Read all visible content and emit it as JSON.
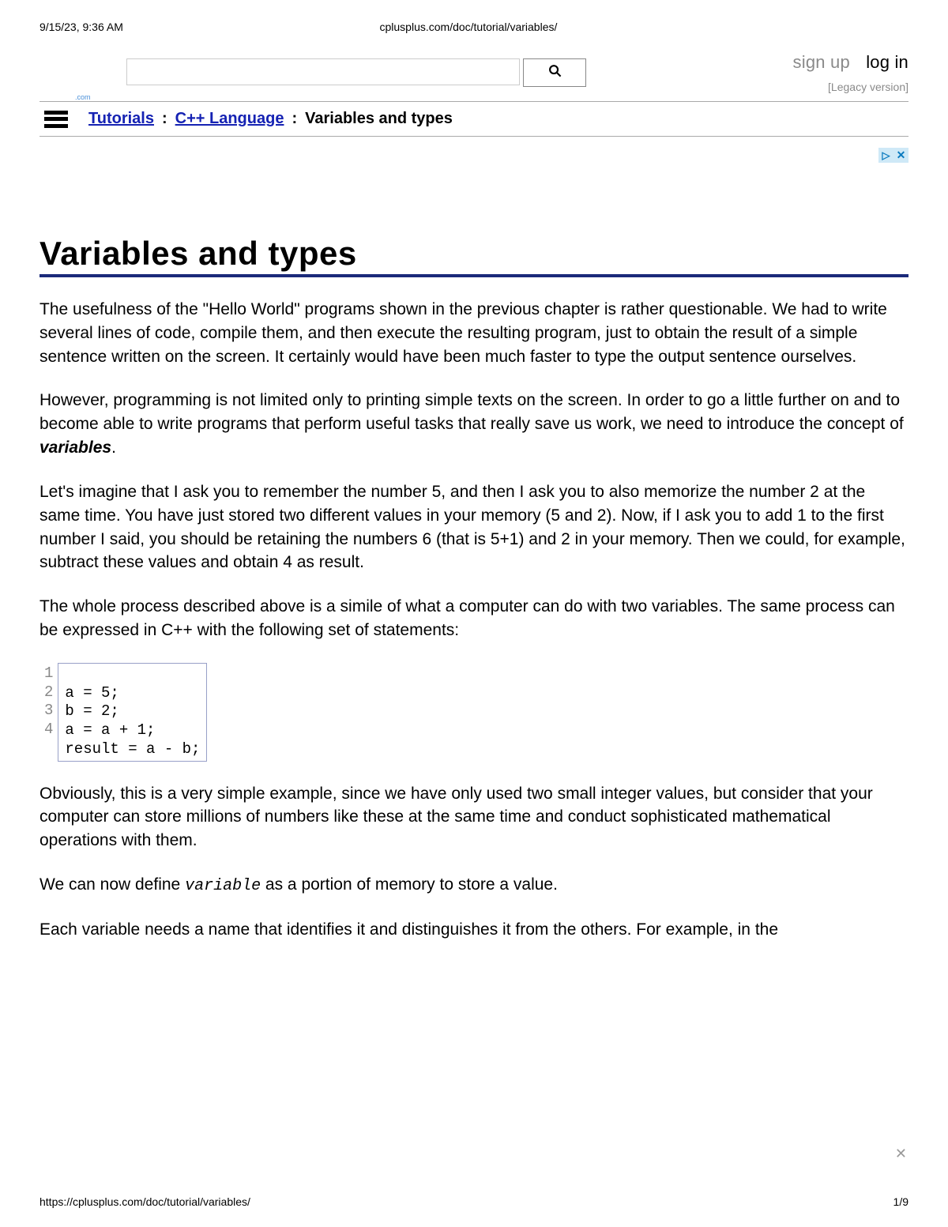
{
  "print_header": {
    "left": "9/15/23, 9:36 AM",
    "center": "cplusplus.com/doc/tutorial/variables/"
  },
  "header": {
    "signup": "sign up",
    "login": "log in",
    "legacy": "[Legacy version]",
    "search_placeholder": "",
    "logo_fragment": ".com"
  },
  "breadcrumb": {
    "link1": "Tutorials",
    "link2": "C++ Language",
    "current": "Variables and types",
    "sep": ":"
  },
  "ad": {
    "play": "▷",
    "close": "✕"
  },
  "article": {
    "title": "Variables and types",
    "p1": "The usefulness of the \"Hello World\" programs shown in the previous chapter is rather questionable. We had to write several lines of code, compile them, and then execute the resulting program, just to obtain the result of a simple sentence written on the screen. It certainly would have been much faster to type the output sentence ourselves.",
    "p2_a": "However, programming is not limited only to printing simple texts on the screen. In order to go a little further on and to become able to write programs that perform useful tasks that really save us work, we need to introduce the concept of ",
    "p2_var": "variables",
    "p2_b": ".",
    "p3": "Let's imagine that I ask you to remember the number 5, and then I ask you to also memorize the number 2 at the same time. You have just stored two different values in your memory (5 and 2). Now, if I ask you to add 1 to the first number I said, you should be retaining the numbers 6 (that is 5+1) and 2 in your memory. Then we could, for example, subtract these values and obtain 4 as result.",
    "p4": "The whole process described above is a simile of what a computer can do with two variables. The same process can be expressed in C++ with the following set of statements:",
    "code_lines": {
      "n1": "1",
      "l1": "a = 5;",
      "n2": "2",
      "l2": "b = 2;",
      "n3": "3",
      "l3": "a = a + 1;",
      "n4": "4",
      "l4": "result = a - b;"
    },
    "p5": "Obviously, this is a very simple example, since we have only used two small integer values, but consider that your computer can store millions of numbers like these at the same time and conduct sophisticated mathematical operations with them.",
    "p6_a": "We can now define ",
    "p6_code": "variable",
    "p6_b": " as a portion of memory to store a value.",
    "p7": "Each variable needs a name that identifies it and distinguishes it from the others. For example, in the"
  },
  "close_float": "✕",
  "footer": {
    "url": "https://cplusplus.com/doc/tutorial/variables/",
    "page": "1/9"
  }
}
